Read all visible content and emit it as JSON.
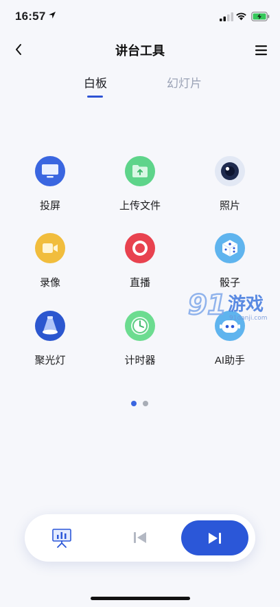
{
  "status_bar": {
    "time": "16:57"
  },
  "nav": {
    "title": "讲台工具"
  },
  "tabs": [
    {
      "label": "白板",
      "active": true
    },
    {
      "label": "幻灯片",
      "active": false
    }
  ],
  "tools": [
    {
      "label": "投屏",
      "icon": "monitor-icon",
      "color": "#3a66e0"
    },
    {
      "label": "上传文件",
      "icon": "folder-upload-icon",
      "color": "#5ed48a"
    },
    {
      "label": "照片",
      "icon": "camera-lens-icon",
      "color": "#dde3ef"
    },
    {
      "label": "录像",
      "icon": "video-camera-icon",
      "color": "#f1bd3d"
    },
    {
      "label": "直播",
      "icon": "live-record-icon",
      "color": "#e8424f"
    },
    {
      "label": "骰子",
      "icon": "dice-icon",
      "color": "#5fb4ee"
    },
    {
      "label": "聚光灯",
      "icon": "spotlight-icon",
      "color": "#2c57cf"
    },
    {
      "label": "计时器",
      "icon": "timer-icon",
      "color": "#6cdc90"
    },
    {
      "label": "AI助手",
      "icon": "robot-icon",
      "color": "#5fb4ee"
    }
  ],
  "pager": {
    "current": 1,
    "total": 2
  },
  "watermark": {
    "text": "91游戏",
    "url_text": "91danji.com"
  },
  "colors": {
    "accent": "#2b57d8",
    "background": "#f6f7fb"
  }
}
